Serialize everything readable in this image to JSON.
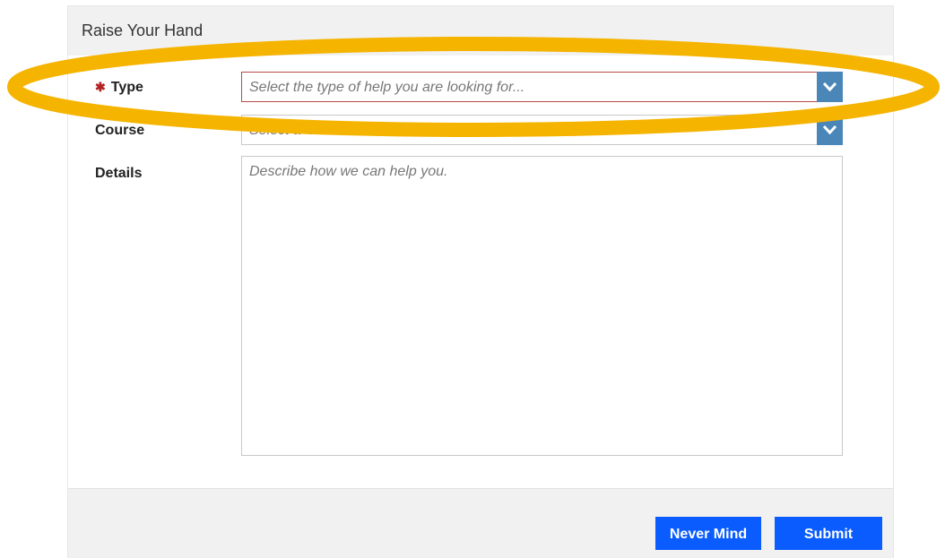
{
  "dialog": {
    "title": "Raise Your Hand"
  },
  "form": {
    "type": {
      "required_mark": "✱",
      "label": "Type",
      "placeholder": "Select the type of help you are looking for..."
    },
    "course": {
      "label": "Course",
      "placeholder": "Select a Course..."
    },
    "details": {
      "label": "Details",
      "placeholder": "Describe how we can help you."
    }
  },
  "footer": {
    "never_mind_label": "Never Mind",
    "submit_label": "Submit"
  },
  "colors": {
    "button": "#0a5cff",
    "dropdown_arrow": "#4a86b8",
    "invalid_border": "#b94a48",
    "highlight": "#f5b400"
  }
}
